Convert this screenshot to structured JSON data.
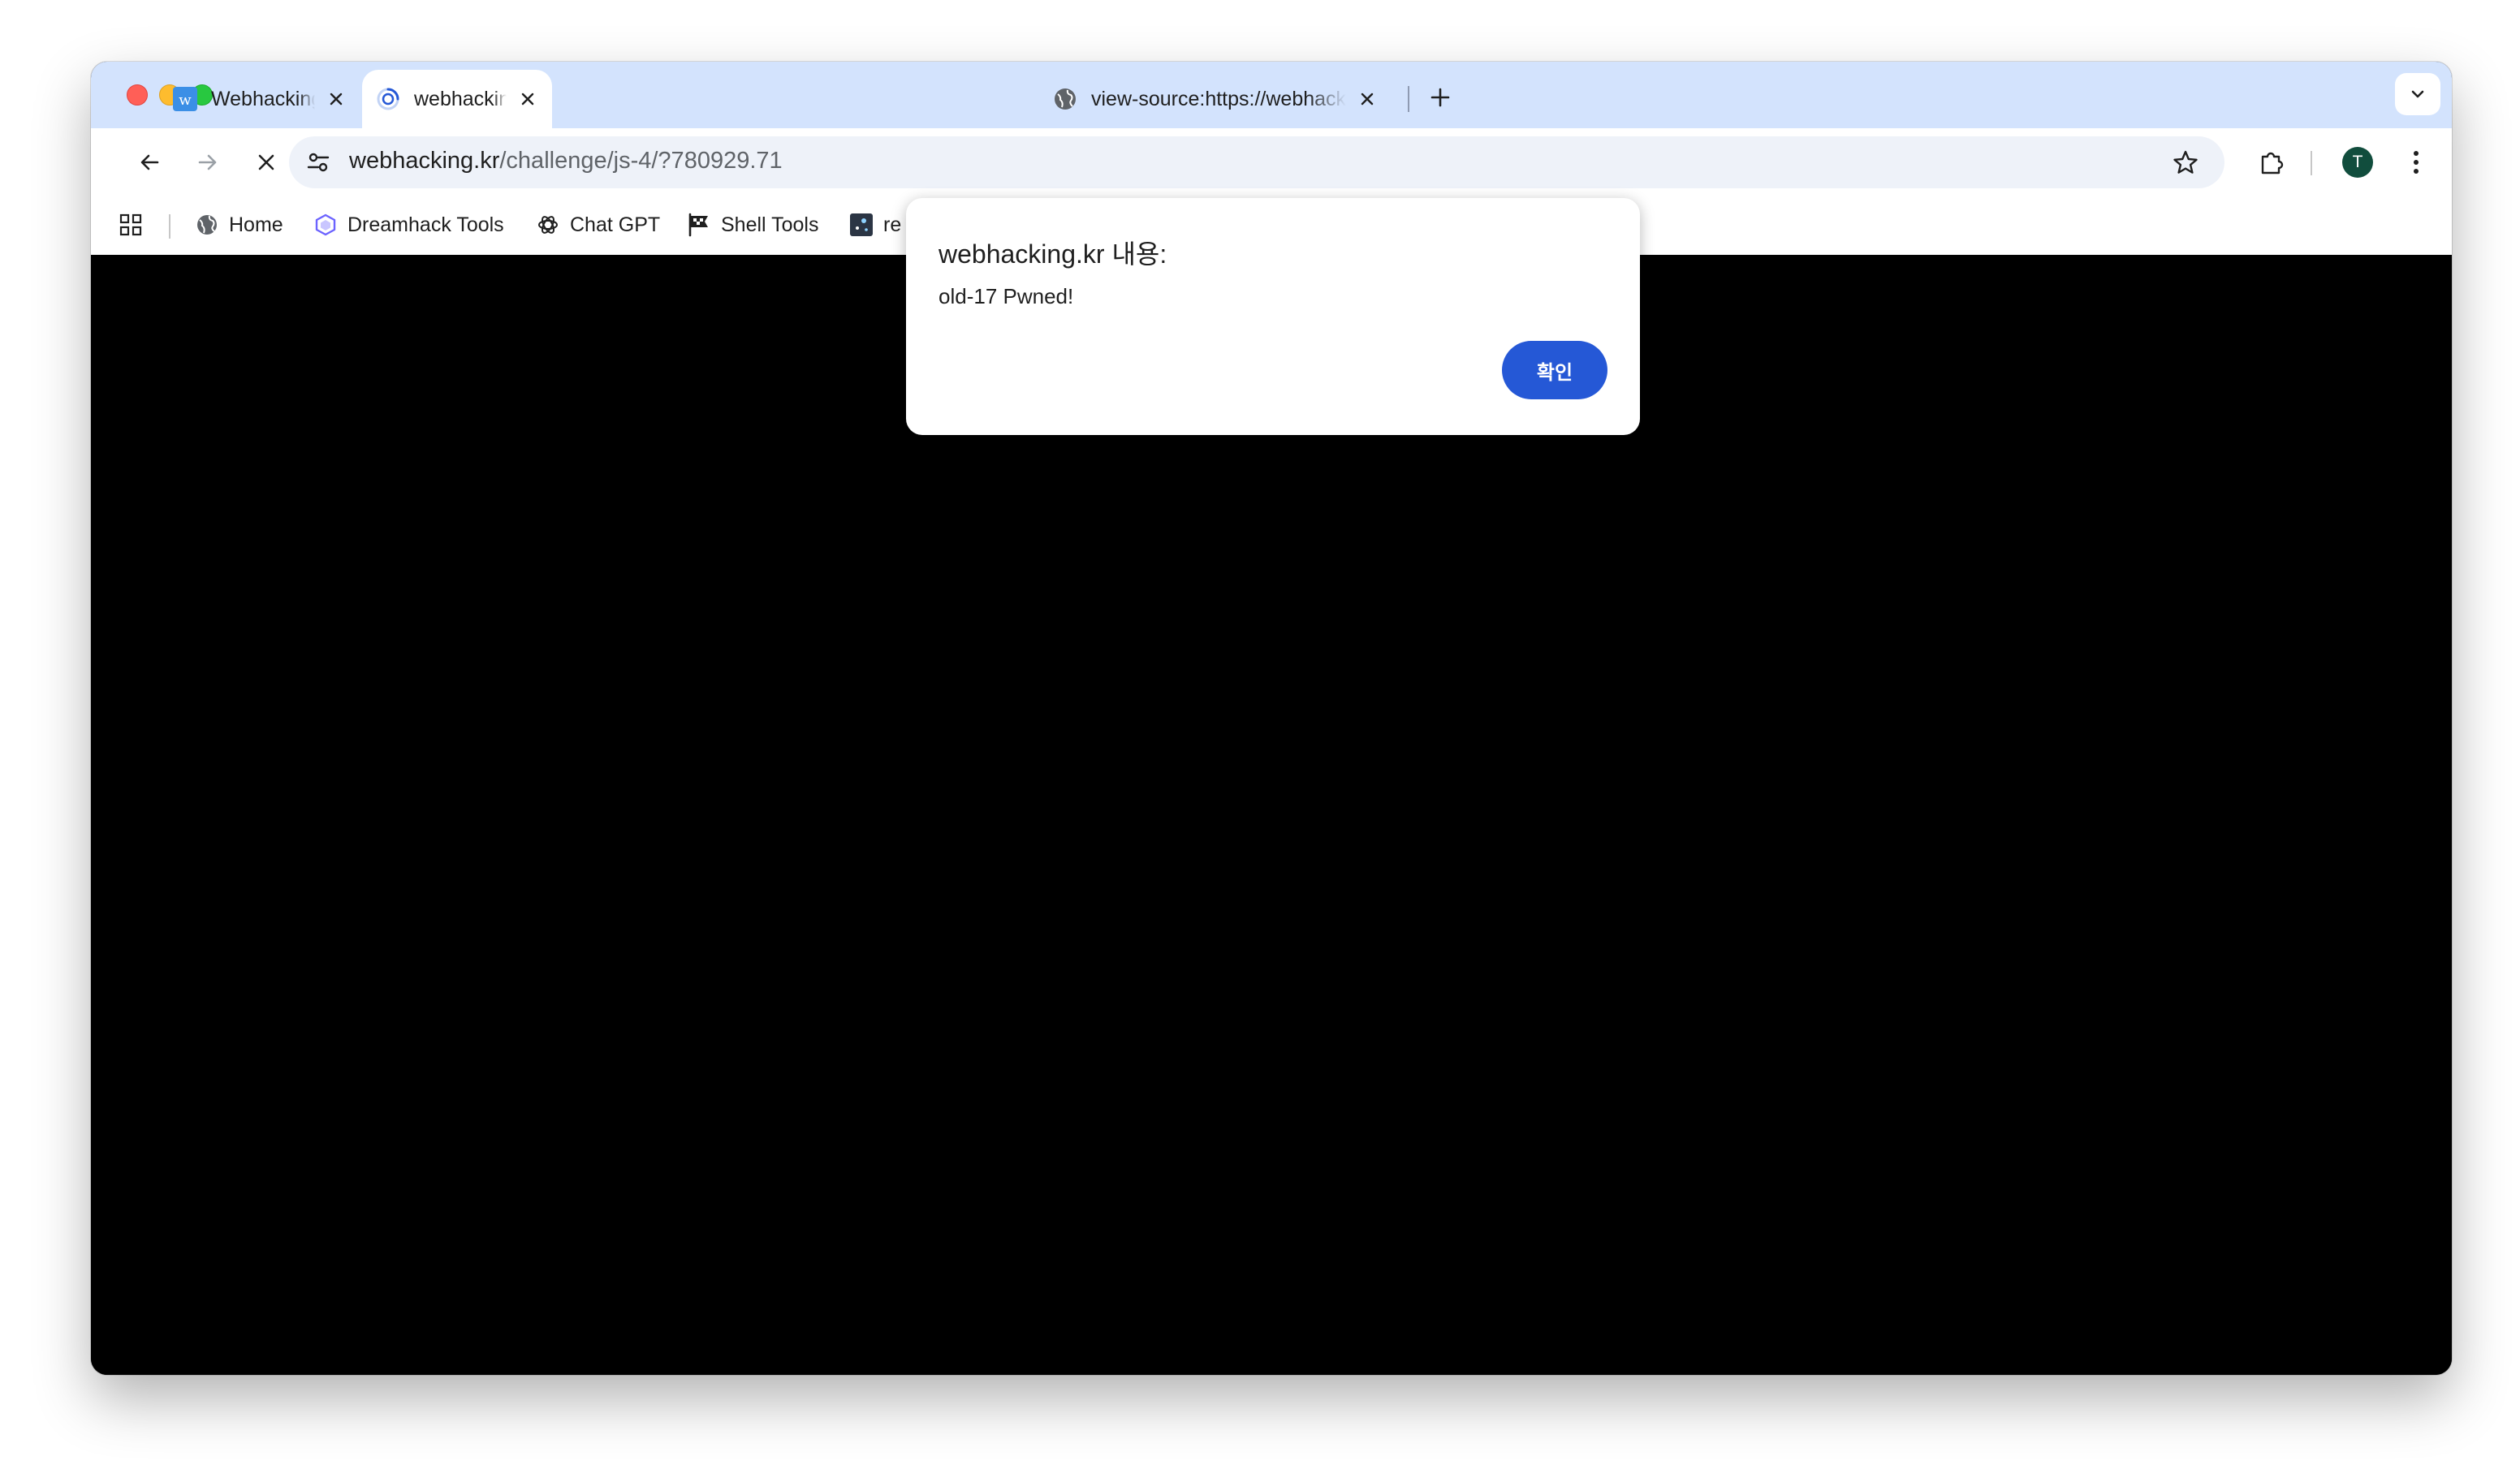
{
  "browser": {
    "tabs": [
      {
        "title": "Webhacking.kr",
        "favicon": "webhacking-w-icon",
        "active": false
      },
      {
        "title": "webhacking.kr/challenge/js-4/?780929.71",
        "favicon": "loading-spinner-icon",
        "active": true
      },
      {
        "title": "view-source:https://webhacking.kr/challenge/js-4/",
        "favicon": "globe-icon",
        "active": false
      }
    ],
    "new_tab_icon": "plus-icon",
    "tab_search_icon": "chevron-down-icon"
  },
  "toolbar": {
    "url_host": "webhacking.kr",
    "url_path": "/challenge/js-4/?780929.71",
    "back_icon": "arrow-left-icon",
    "forward_icon": "arrow-right-icon",
    "stop_icon": "close-icon",
    "site_info_icon": "tune-icon",
    "bookmark_icon": "star-icon",
    "extensions_icon": "puzzle-icon",
    "profile_initial": "T",
    "profile_color": "#114d3d",
    "menu_icon": "more-vertical-icon"
  },
  "bookmarks": [
    {
      "label": "Home",
      "icon": "globe-icon"
    },
    {
      "label": "Dreamhack Tools",
      "icon": "hexagon-icon"
    },
    {
      "label": "Chat GPT",
      "icon": "openai-icon"
    },
    {
      "label": "Shell Tools",
      "icon": "flag-icon"
    },
    {
      "label": "re",
      "icon": "app-icon"
    }
  ],
  "dialog": {
    "title": "webhacking.kr 내용:",
    "message": "old-17 Pwned!",
    "ok_label": "확인",
    "ok_color": "#2558d6"
  },
  "colors": {
    "tabstrip": "#d3e3fd",
    "page_background": "#000000"
  }
}
